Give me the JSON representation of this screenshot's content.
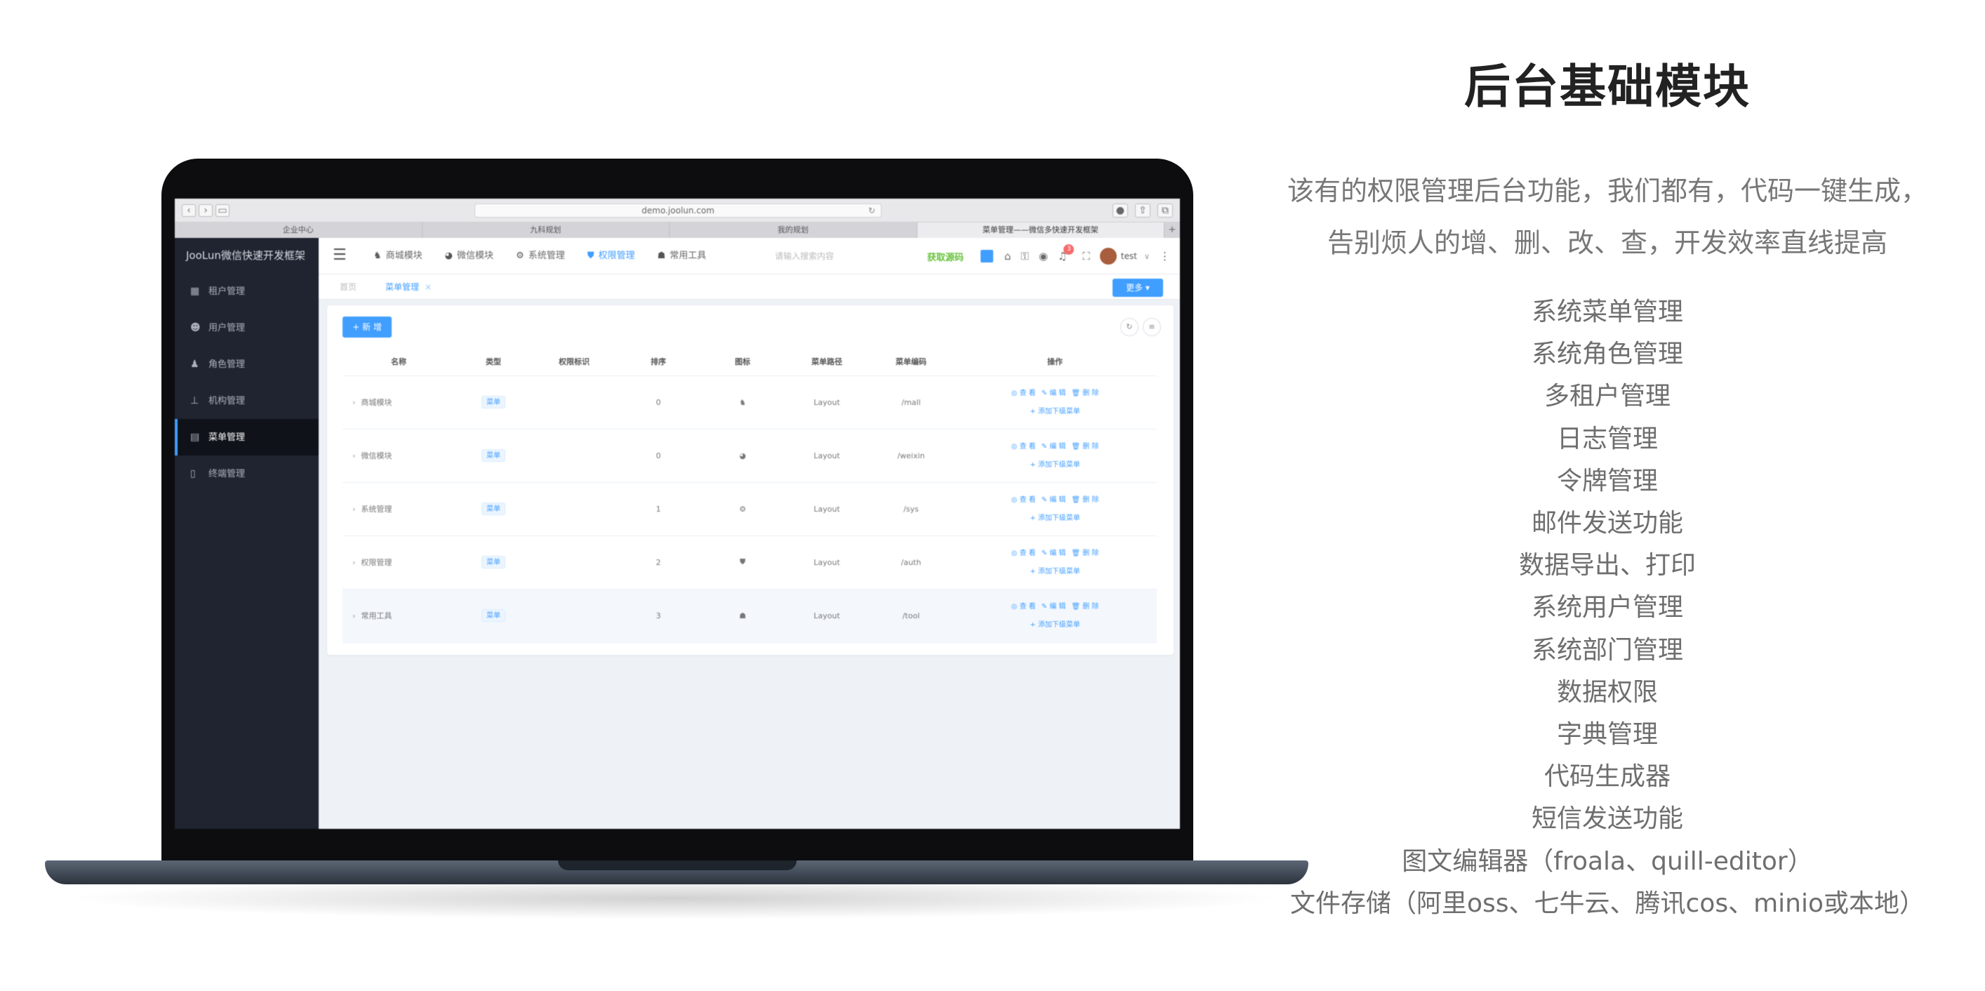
{
  "hero": {
    "title": "后台基础模块",
    "desc_line1": "该有的权限管理后台功能，我们都有，代码一键生成，",
    "desc_line2": "告别烦人的增、删、改、查，开发效率直线提高"
  },
  "features": [
    "系统菜单管理",
    "系统角色管理",
    "多租户管理",
    "日志管理",
    "令牌管理",
    "邮件发送功能",
    "数据导出、打印",
    "系统用户管理",
    "系统部门管理",
    "数据权限",
    "字典管理",
    "代码生成器",
    "短信发送功能",
    "图文编辑器（froala、quill-editor）",
    "文件存储（阿里oss、七牛云、腾讯cos、minio或本地）"
  ],
  "browser": {
    "url": "demo.joolun.com",
    "tabs": [
      "企业中心",
      "九科规划",
      "我的规划",
      "菜单管理——微信多快速开发框架"
    ]
  },
  "sidebar": {
    "logo": "JooLun微信快速开发框架",
    "items": [
      {
        "label": "租户管理",
        "icon": "grid-icon"
      },
      {
        "label": "用户管理",
        "icon": "user-icon"
      },
      {
        "label": "角色管理",
        "icon": "role-icon"
      },
      {
        "label": "机构管理",
        "icon": "org-icon"
      },
      {
        "label": "菜单管理",
        "icon": "menu-icon"
      },
      {
        "label": "终端管理",
        "icon": "device-icon"
      }
    ],
    "active_index": 4
  },
  "header": {
    "nav": [
      {
        "label": "商城模块",
        "icon": "shop-icon"
      },
      {
        "label": "微信模块",
        "icon": "wechat-icon"
      },
      {
        "label": "系统管理",
        "icon": "gear-icon"
      },
      {
        "label": "权限管理",
        "icon": "shield-icon"
      },
      {
        "label": "常用工具",
        "icon": "toolbox-icon"
      }
    ],
    "active_nav": 3,
    "search_placeholder": "请输入搜索内容",
    "get_code": "获取源码",
    "badge_count": "3",
    "username": "test"
  },
  "tags": {
    "home": "首页",
    "current": "菜单管理",
    "more_button": "更多"
  },
  "content": {
    "new_button": "+ 新 增",
    "columns": [
      "名称",
      "类型",
      "权限标识",
      "排序",
      "图标",
      "菜单路径",
      "菜单编码",
      "操作"
    ],
    "rows": [
      {
        "name": "商城模块",
        "type": "菜单",
        "perm": "",
        "sort": "0",
        "icon": "♞",
        "path": "Layout",
        "code": "/mall"
      },
      {
        "name": "微信模块",
        "type": "菜单",
        "perm": "",
        "sort": "0",
        "icon": "◕",
        "path": "Layout",
        "code": "/weixin"
      },
      {
        "name": "系统管理",
        "type": "菜单",
        "perm": "",
        "sort": "1",
        "icon": "⚙",
        "path": "Layout",
        "code": "/sys"
      },
      {
        "name": "权限管理",
        "type": "菜单",
        "perm": "",
        "sort": "2",
        "icon": "⛊",
        "path": "Layout",
        "code": "/auth"
      },
      {
        "name": "常用工具",
        "type": "菜单",
        "perm": "",
        "sort": "3",
        "icon": "☗",
        "path": "Layout",
        "code": "/tool"
      }
    ],
    "ops": {
      "view": "查 看",
      "edit": "编 辑",
      "delete": "删 除",
      "add_child": "添加下级菜单"
    }
  }
}
